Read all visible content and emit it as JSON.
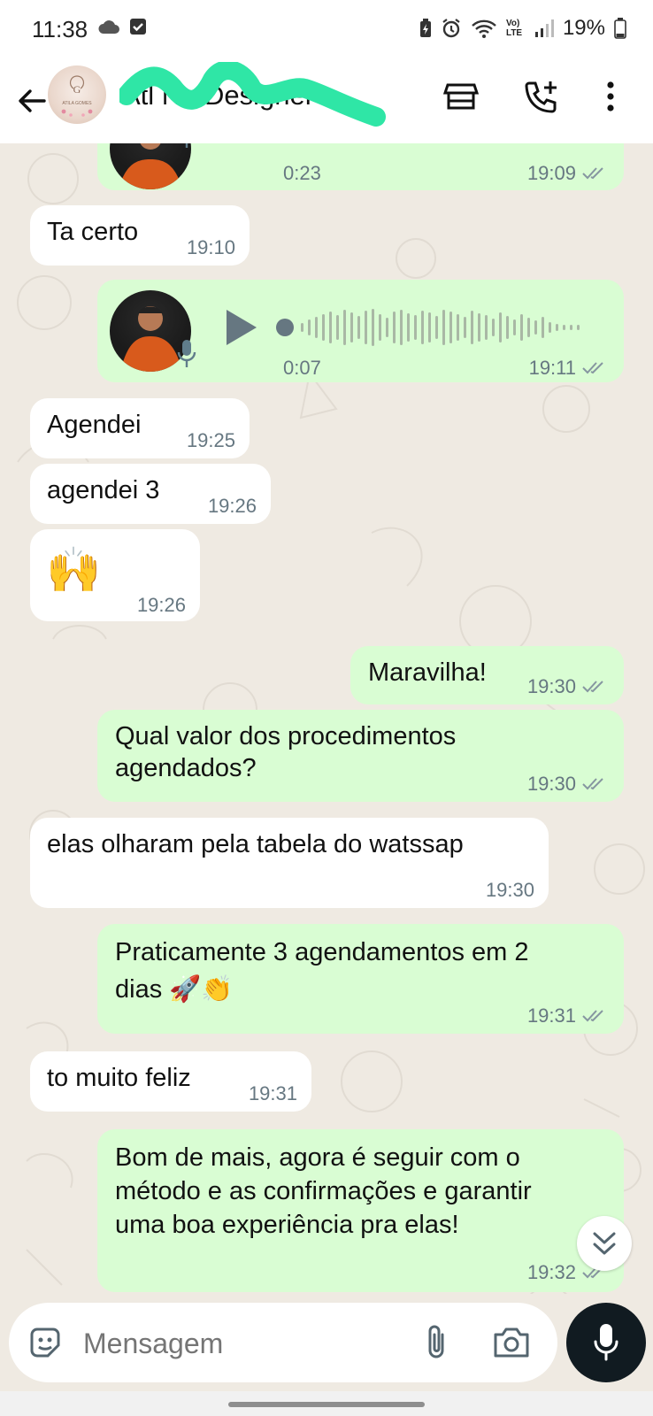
{
  "status_bar": {
    "time": "11:38",
    "battery": "19%",
    "network": "Vo) LTE",
    "left_icons": [
      "cloud-icon",
      "check-box-icon"
    ],
    "right_icons": [
      "battery-saver-icon",
      "alarm-icon",
      "wifi-icon",
      "signal-icon",
      "battery-icon"
    ]
  },
  "header": {
    "contact_name": "Atl Na Designer",
    "avatar_text": "ATILA GOMES",
    "actions": [
      "store-icon",
      "add-call-icon",
      "more-options-icon"
    ]
  },
  "messages": [
    {
      "dir": "out",
      "type": "voice",
      "duration": "0:23",
      "time": "19:09",
      "status": "read"
    },
    {
      "dir": "in",
      "type": "text",
      "text": "Ta certo",
      "time": "19:10"
    },
    {
      "dir": "out",
      "type": "voice",
      "duration": "0:07",
      "time": "19:11",
      "status": "read"
    },
    {
      "dir": "in",
      "type": "text",
      "text": "Agendei",
      "time": "19:25"
    },
    {
      "dir": "in",
      "type": "text",
      "text": "agendei 3",
      "time": "19:26"
    },
    {
      "dir": "in",
      "type": "emoji",
      "text": "🙌",
      "time": "19:26"
    },
    {
      "dir": "out",
      "type": "text",
      "text": "Maravilha!",
      "time": "19:30",
      "status": "read"
    },
    {
      "dir": "out",
      "type": "text",
      "lines": [
        "Qual valor dos procedimentos",
        "agendados?"
      ],
      "time": "19:30",
      "status": "read"
    },
    {
      "dir": "in",
      "type": "text",
      "text": "elas olharam pela tabela do watssap",
      "time": "19:30"
    },
    {
      "dir": "out",
      "type": "text",
      "lines": [
        "Praticamente 3 agendamentos em 2",
        "dias 🚀👏"
      ],
      "time": "19:31",
      "status": "read"
    },
    {
      "dir": "in",
      "type": "text",
      "text": "to muito feliz",
      "time": "19:31"
    },
    {
      "dir": "out",
      "type": "text",
      "lines": [
        "Bom de mais, agora é seguir com o",
        "método e as confirmações e garantir",
        "uma boa experiência pra elas!"
      ],
      "time": "19:32",
      "status": "read"
    }
  ],
  "composer": {
    "placeholder": "Mensagem",
    "icons": [
      "sticker-icon",
      "attach-icon",
      "camera-icon",
      "mic-icon"
    ]
  },
  "colors": {
    "outgoing_bubble": "#d9fdd3",
    "incoming_bubble": "#ffffff",
    "chat_background": "#efeae2",
    "meta_text": "#667781",
    "read_ticks": "#8696a0"
  }
}
